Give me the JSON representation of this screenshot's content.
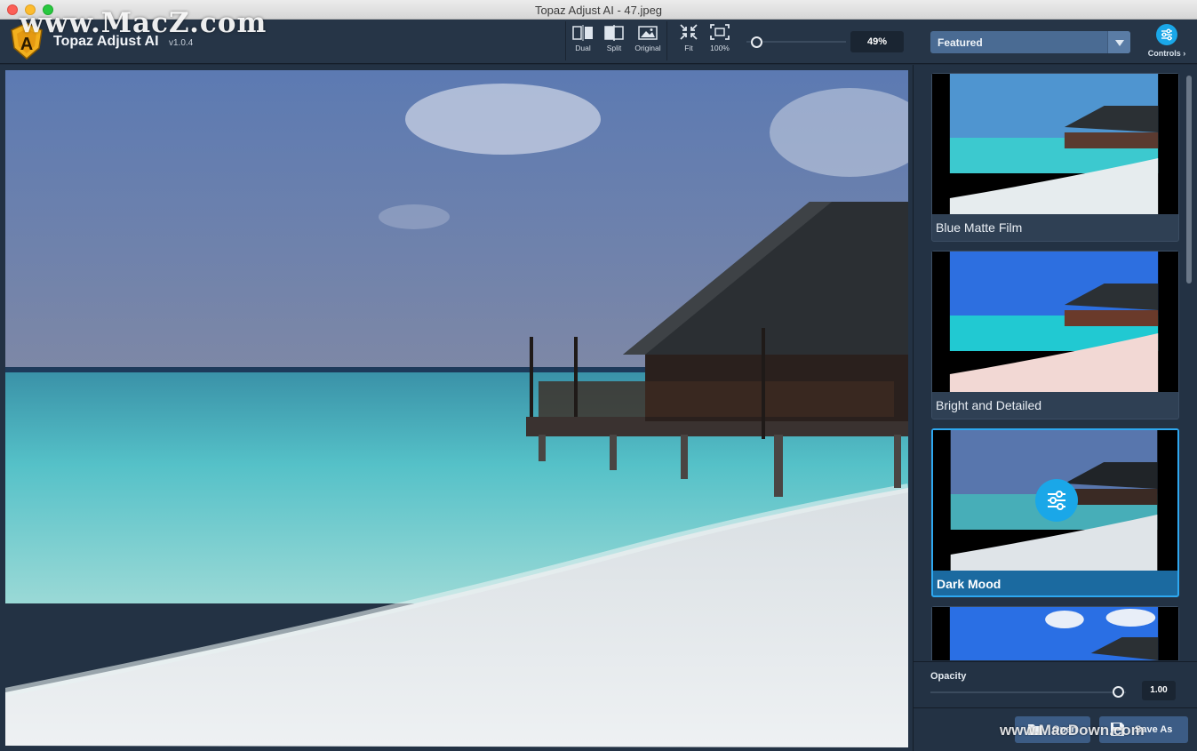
{
  "window": {
    "title": "Topaz Adjust AI - 47.jpeg"
  },
  "watermark": {
    "top": "www.MacZ.com",
    "bottom": "www.MacDown.com"
  },
  "app": {
    "name": "Topaz Adjust AI",
    "version": "v1.0.4"
  },
  "toolbar": {
    "view_modes": [
      {
        "label": "Dual",
        "icon": "dual-view-icon"
      },
      {
        "label": "Split",
        "icon": "split-view-icon"
      },
      {
        "label": "Original",
        "icon": "original-view-icon"
      }
    ],
    "zoom_buttons": [
      {
        "label": "Fit",
        "icon": "fit-icon"
      },
      {
        "label": "100%",
        "icon": "actual-size-icon"
      }
    ],
    "zoom_value": "49%",
    "zoom_level": 0.05
  },
  "sidebar": {
    "preset_category": "Featured",
    "controls_label": "Controls",
    "presets": [
      {
        "label": "Blue Matte Film",
        "selected": false
      },
      {
        "label": "Bright and Detailed",
        "selected": false
      },
      {
        "label": "Dark Mood",
        "selected": true
      },
      {
        "label": "",
        "selected": false
      }
    ],
    "opacity": {
      "label": "Opacity",
      "value": "1.00"
    },
    "buttons": {
      "open": "Open",
      "save_as": "Save As"
    }
  },
  "colors": {
    "accent": "#1aa7e8",
    "panel": "#233244",
    "toolbar": "#263547",
    "button": "#3c5c85",
    "dropdown": "#4a6b93"
  }
}
